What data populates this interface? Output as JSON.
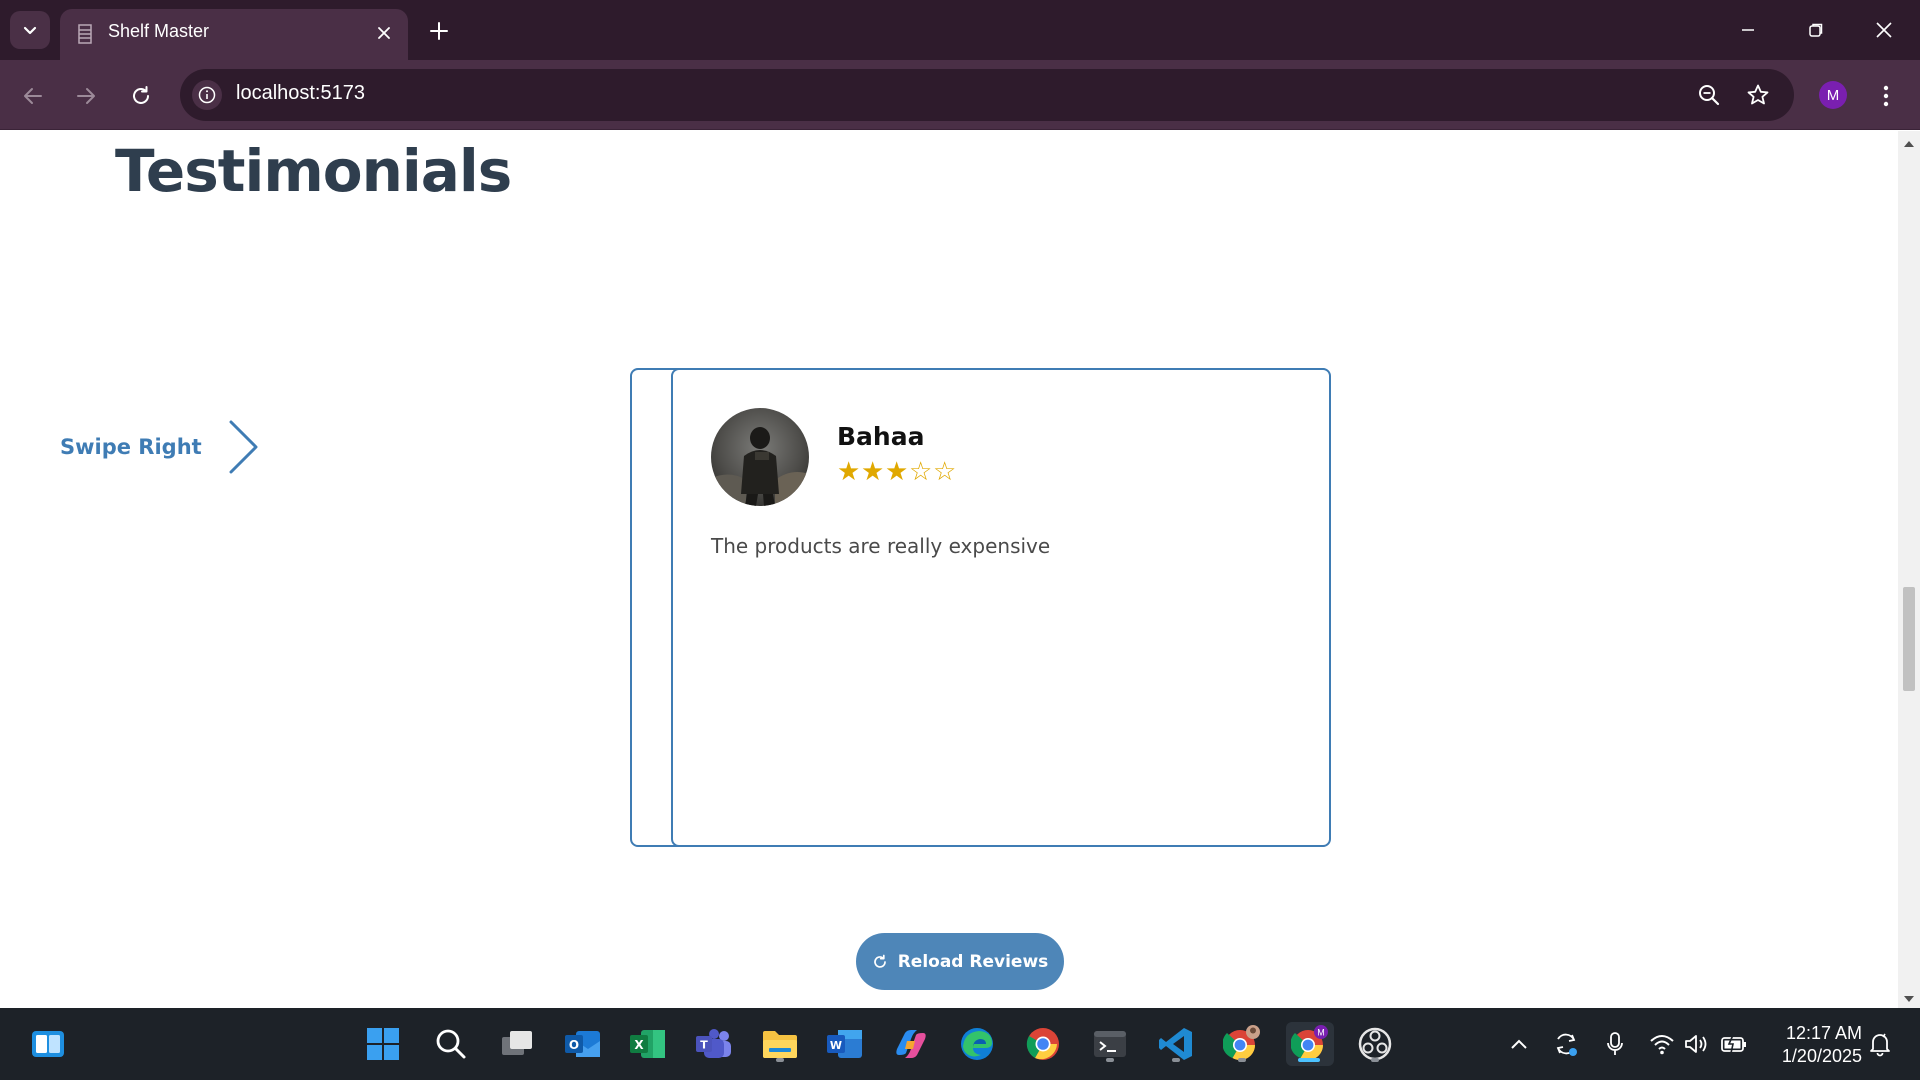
{
  "browser": {
    "tab_title": "Shelf Master",
    "url": "localhost:5173",
    "profile_initial": "M"
  },
  "page": {
    "title": "Testimonials",
    "swipe_label": "Swipe Right",
    "review": {
      "name": "Bahaa",
      "rating": 3,
      "max_rating": 5,
      "stars_text": "★★★☆☆",
      "text": "The products are really expensive"
    },
    "reload_label": "Reload Reviews"
  },
  "taskbar": {
    "time": "12:17 AM",
    "date": "1/20/2025",
    "apps": [
      "start",
      "search",
      "task-view",
      "outlook",
      "excel",
      "teams",
      "file-explorer",
      "word",
      "copilot",
      "edge",
      "chrome",
      "terminal",
      "vscode",
      "chrome-profile-2",
      "chrome-profile-m",
      "obs"
    ]
  },
  "colors": {
    "accent": "#3f7cb4",
    "button": "#4e86b8",
    "title": "#2f3e4e",
    "star": "#e0a800",
    "browser_frame": "#2e1b2c"
  }
}
